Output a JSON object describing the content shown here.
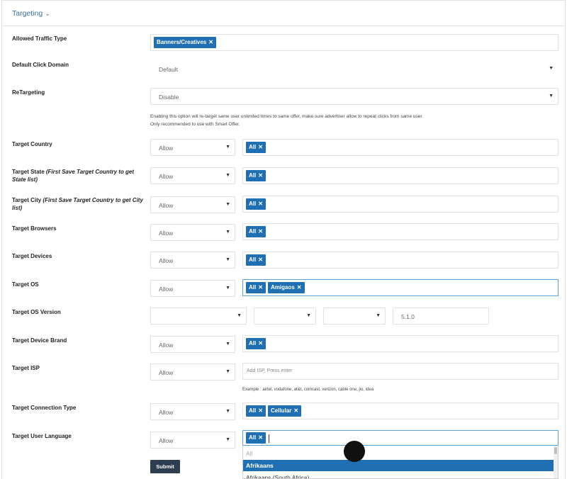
{
  "panel": {
    "title": "Targeting"
  },
  "fields": {
    "allowed_traffic": {
      "label": "Allowed Traffic Type",
      "tags": [
        "Banners/Creatives"
      ]
    },
    "click_domain": {
      "label": "Default Click Domain",
      "value": "Default"
    },
    "retargeting": {
      "label": "ReTargeting",
      "value": "Disable",
      "help1": "Enabling this option will re-target same user unlimited times to same offer, make sure advertiser allow to repeat clicks from same user.",
      "help2": "Only recommended to use with Smart Offer."
    },
    "country": {
      "label": "Target Country",
      "mode": "Allow",
      "tags": [
        "All"
      ]
    },
    "state": {
      "label": "Target State ",
      "hint": "(First Save Target Country to get State list)",
      "mode": "Allow",
      "tags": [
        "All"
      ]
    },
    "city": {
      "label": "Target City ",
      "hint": "(First Save Target Country to get City list)",
      "mode": "Allow",
      "tags": [
        "All"
      ]
    },
    "browsers": {
      "label": "Target Browsers",
      "mode": "Allow",
      "tags": [
        "All"
      ]
    },
    "devices": {
      "label": "Target Devices",
      "mode": "Allow",
      "tags": [
        "All"
      ]
    },
    "os": {
      "label": "Target OS",
      "mode": "Allow",
      "tags": [
        "All",
        "Amigaos"
      ]
    },
    "os_version": {
      "label": "Target OS Version",
      "version": "5.1.0"
    },
    "device_brand": {
      "label": "Target Device Brand",
      "mode": "Allow",
      "tags": [
        "All"
      ]
    },
    "isp": {
      "label": "Target ISP",
      "mode": "Allow",
      "placeholder": "Add ISP, Press enter",
      "example": "Example : airtel, vodafone, at&t, comcast, verizon, cable one, jio, idea"
    },
    "connection": {
      "label": "Target Connection Type",
      "mode": "Allow",
      "tags": [
        "All",
        "Cellular"
      ]
    },
    "language": {
      "label": "Target User Language",
      "mode": "Allow",
      "tags": [
        "All"
      ]
    }
  },
  "dropdown": {
    "items": [
      "All",
      "Afrikaans",
      "Afrikaans (South Africa)"
    ],
    "highlighted": "Afrikaans"
  },
  "submit_label": "Submit",
  "icons": {
    "remove": "close-icon",
    "caret": "caret-down-icon",
    "collapse": "chevron-down-icon"
  },
  "colors": {
    "tag": "#1f6fb2",
    "title": "#3b6e98",
    "submit": "#2c3e50"
  }
}
